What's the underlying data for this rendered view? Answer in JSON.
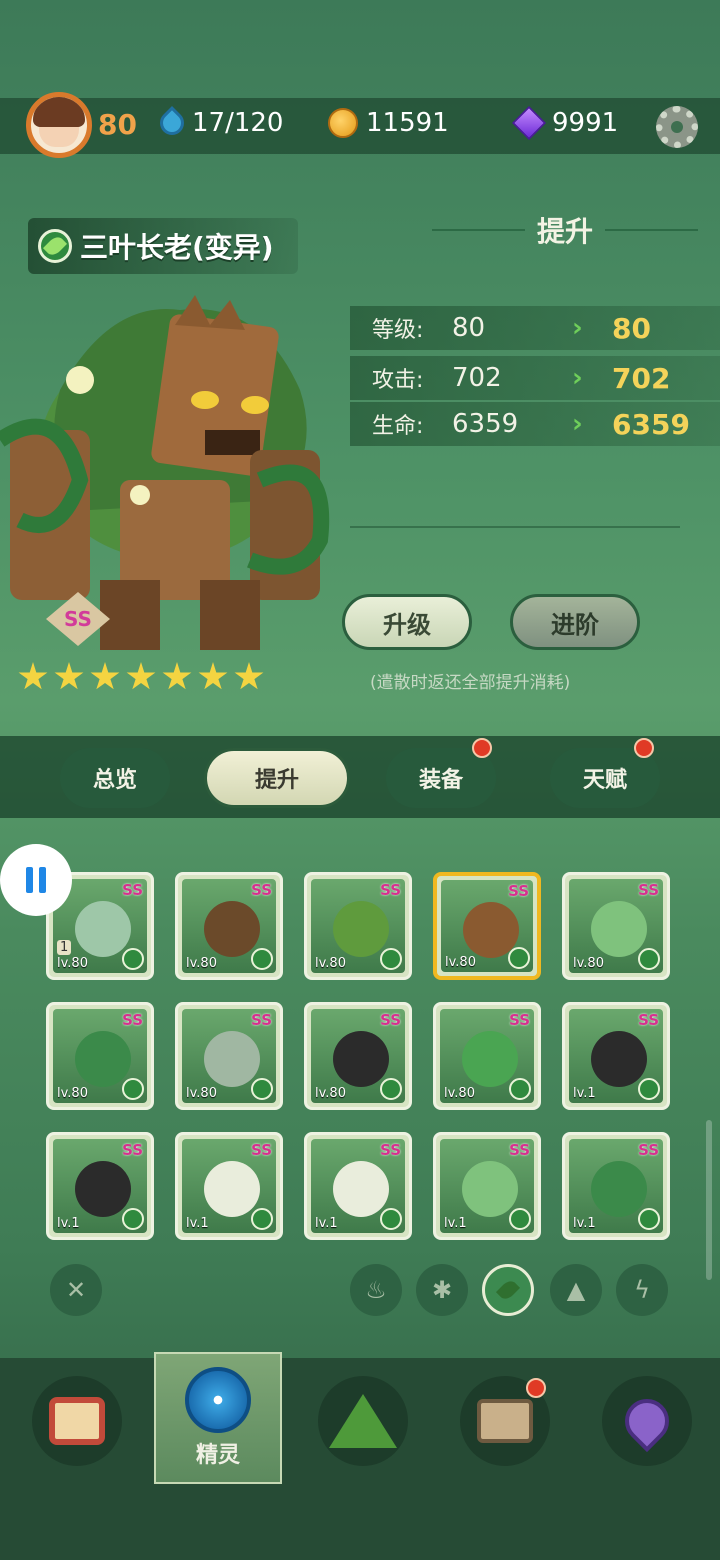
{
  "header": {
    "player_level": "80",
    "energy": "17/120",
    "coins": "11591",
    "gems": "9991"
  },
  "hero": {
    "name": "三叶长老(变异)",
    "rarity": "SS",
    "stars": 7
  },
  "upgrade_panel": {
    "title": "提升",
    "stats": [
      {
        "label": "等级:",
        "current": "80",
        "next": "80"
      },
      {
        "label": "攻击:",
        "current": "702",
        "next": "702"
      },
      {
        "label": "生命:",
        "current": "6359",
        "next": "6359"
      }
    ],
    "arrow": "›",
    "level_up_label": "升级",
    "advance_label": "进阶",
    "note": "(遣散时返还全部提升消耗)"
  },
  "tabs": [
    {
      "label": "总览",
      "active": false,
      "badge": false
    },
    {
      "label": "提升",
      "active": true,
      "badge": false
    },
    {
      "label": "装备",
      "active": false,
      "badge": true
    },
    {
      "label": "天赋",
      "active": false,
      "badge": true
    }
  ],
  "roster": [
    {
      "rarity": "SS",
      "level": "lv.80",
      "color": "#9ec7a8"
    },
    {
      "rarity": "SS",
      "level": "lv.80",
      "color": "#6b4a2a"
    },
    {
      "rarity": "SS",
      "level": "lv.80",
      "color": "#5f9b3d"
    },
    {
      "rarity": "SS",
      "level": "lv.80",
      "color": "#8a5a30"
    },
    {
      "rarity": "SS",
      "level": "lv.80",
      "color": "#7fc27d"
    },
    {
      "rarity": "SS",
      "level": "lv.80",
      "color": "#3b8a4a"
    },
    {
      "rarity": "SS",
      "level": "lv.80",
      "color": "#a0b7a2"
    },
    {
      "rarity": "SS",
      "level": "lv.80",
      "color": "#2b2b2b"
    },
    {
      "rarity": "SS",
      "level": "lv.80",
      "color": "#4aa552"
    },
    {
      "rarity": "SS",
      "level": "lv.1",
      "color": "#2b2b2b"
    },
    {
      "rarity": "SS",
      "level": "lv.1",
      "color": "#2b2b2b"
    },
    {
      "rarity": "SS",
      "level": "lv.1",
      "color": "#e9eddc"
    },
    {
      "rarity": "SS",
      "level": "lv.1",
      "color": "#e9eddc"
    },
    {
      "rarity": "SS",
      "level": "lv.1",
      "color": "#7fc27d"
    },
    {
      "rarity": "SS",
      "level": "lv.1",
      "color": "#3b8a4a"
    }
  ],
  "first_card_count": "1",
  "element_filters": [
    "clear",
    "fire",
    "wind",
    "nature",
    "earth",
    "lightning"
  ],
  "bottom_nav": {
    "active_label": "精灵"
  },
  "colors": {
    "accent_gold": "#f4d35a",
    "rarity_pink": "#d8308f",
    "badge_red": "#e03a25"
  }
}
